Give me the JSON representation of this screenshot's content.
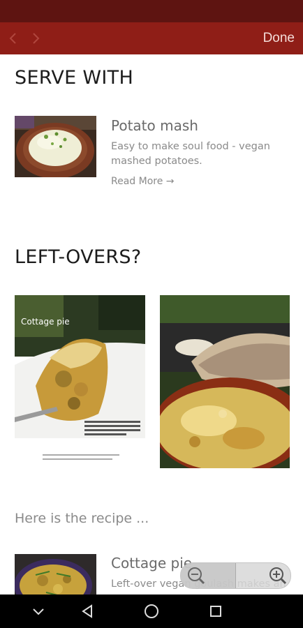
{
  "toolbar": {
    "back_icon": "chevron-left-icon",
    "forward_icon": "chevron-right-icon",
    "done_label": "Done"
  },
  "serve_with": {
    "heading": "SERVE WITH",
    "card": {
      "title": "Potato mash",
      "description": "Easy to make soul food - vegan mashed potatoes.",
      "read_more": "Read More →"
    }
  },
  "leftovers": {
    "heading": "LEFT-OVERS?",
    "image1_caption": "Cottage pie",
    "recipe_note": "Here is the recipe ...",
    "card": {
      "title": "Cottage pie",
      "description": "Left-over vegan goulash makes an"
    }
  },
  "zoom": {
    "out_icon": "zoom-out-icon",
    "in_icon": "zoom-in-icon"
  },
  "system_nav": {
    "keyboard_icon": "keyboard-hide-icon",
    "back_icon": "back-triangle-icon",
    "home_icon": "home-circle-icon",
    "recents_icon": "recents-square-icon"
  },
  "colors": {
    "status_bar": "#5e1411",
    "toolbar": "#8f1e17",
    "done_text": "#f4dcd8"
  }
}
